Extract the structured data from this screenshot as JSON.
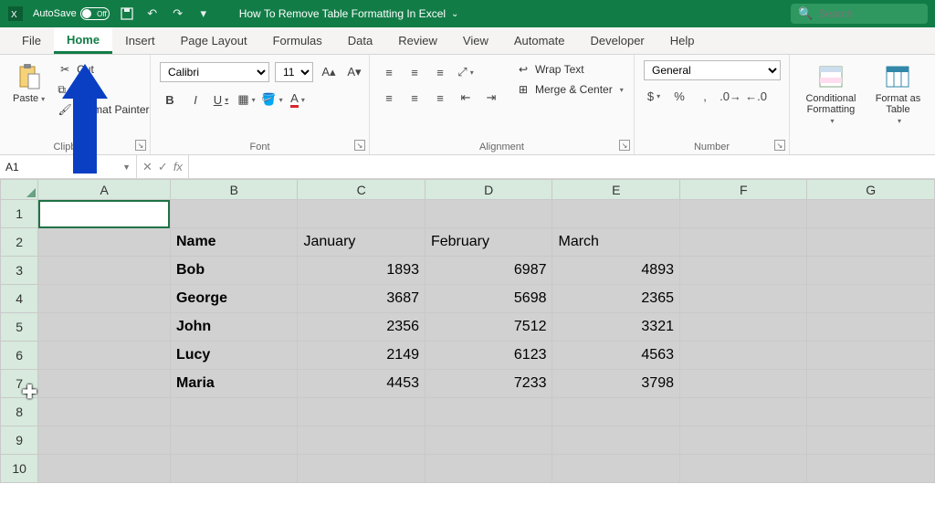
{
  "titlebar": {
    "autosave_label": "AutoSave",
    "autosave_state": "Off",
    "doc_title": "How To Remove Table Formatting In Excel",
    "search_placeholder": "Search"
  },
  "tabs": [
    "File",
    "Home",
    "Insert",
    "Page Layout",
    "Formulas",
    "Data",
    "Review",
    "View",
    "Automate",
    "Developer",
    "Help"
  ],
  "active_tab": "Home",
  "ribbon": {
    "clipboard": {
      "paste": "Paste",
      "cut": "Cut",
      "copy": "Copy",
      "painter": "Format Painter",
      "group": "Clipboard"
    },
    "font": {
      "name": "Calibri",
      "size": "11",
      "bold": "B",
      "italic": "I",
      "underline": "U",
      "group": "Font"
    },
    "alignment": {
      "wrap": "Wrap Text",
      "merge": "Merge & Center",
      "group": "Alignment"
    },
    "number": {
      "format": "General",
      "group": "Number"
    },
    "styles": {
      "cond": "Conditional Formatting",
      "fmt_table": "Format as Table"
    }
  },
  "namebox": "A1",
  "columns": [
    "A",
    "B",
    "C",
    "D",
    "E",
    "F",
    "G"
  ],
  "row_numbers": [
    "1",
    "2",
    "3",
    "4",
    "5",
    "6",
    "7",
    "8",
    "9",
    "10"
  ],
  "cells": {
    "r2": {
      "B": "Name",
      "C": "January",
      "D": "February",
      "E": "March"
    },
    "r3": {
      "B": "Bob",
      "C": "1893",
      "D": "6987",
      "E": "4893"
    },
    "r4": {
      "B": "George",
      "C": "3687",
      "D": "5698",
      "E": "2365"
    },
    "r5": {
      "B": "John",
      "C": "2356",
      "D": "7512",
      "E": "3321"
    },
    "r6": {
      "B": "Lucy",
      "C": "2149",
      "D": "6123",
      "E": "4563"
    },
    "r7": {
      "B": "Maria",
      "C": "4453",
      "D": "7233",
      "E": "3798"
    }
  },
  "chart_data": {
    "type": "table",
    "title": "",
    "categories": [
      "January",
      "February",
      "March"
    ],
    "series": [
      {
        "name": "Bob",
        "values": [
          1893,
          6987,
          4893
        ]
      },
      {
        "name": "George",
        "values": [
          3687,
          5698,
          2365
        ]
      },
      {
        "name": "John",
        "values": [
          2356,
          7512,
          3321
        ]
      },
      {
        "name": "Lucy",
        "values": [
          2149,
          6123,
          4563
        ]
      },
      {
        "name": "Maria",
        "values": [
          4453,
          7233,
          3798
        ]
      }
    ]
  }
}
